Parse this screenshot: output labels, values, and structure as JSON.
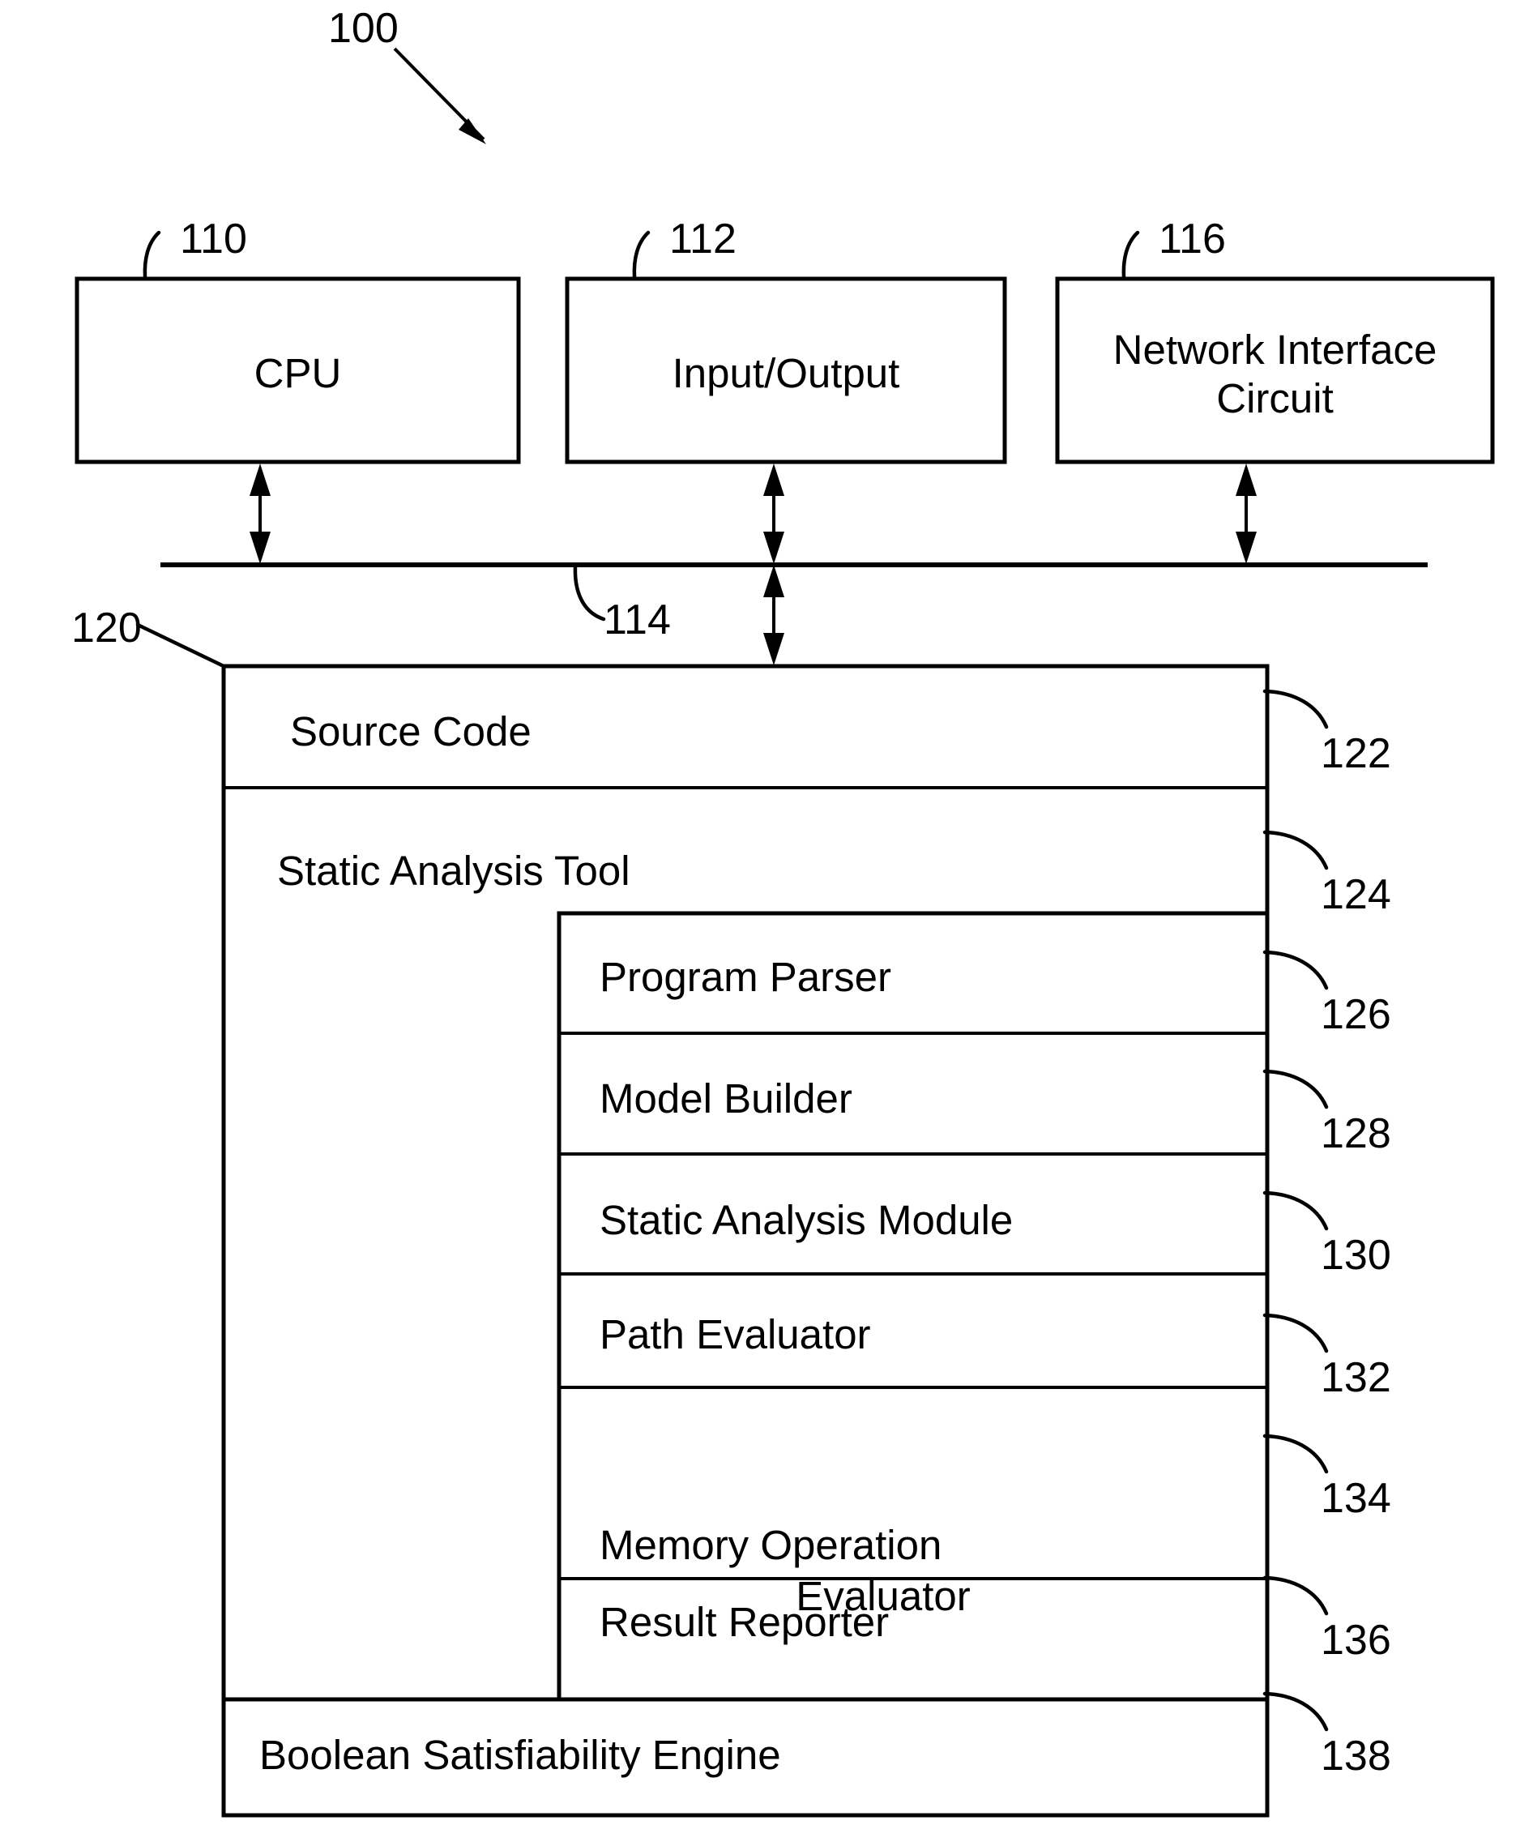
{
  "figure": {
    "system_ref": "100",
    "bus_ref": "114",
    "memory_ref": "120"
  },
  "hardware": {
    "blocks": [
      {
        "label": "CPU",
        "ref": "110"
      },
      {
        "label": "Input/Output",
        "ref": "112"
      },
      {
        "label": "Network Interface\nCircuit",
        "ref": "116"
      }
    ]
  },
  "memory": {
    "source_code": {
      "label": "Source Code",
      "ref": "122"
    },
    "static_analysis_tool": {
      "label": "Static Analysis Tool",
      "ref": "124"
    },
    "modules": [
      {
        "label": "Program Parser",
        "ref": "126"
      },
      {
        "label": "Model Builder",
        "ref": "128"
      },
      {
        "label": "Static Analysis Module",
        "ref": "130"
      },
      {
        "label": "Path Evaluator",
        "ref": "132"
      },
      {
        "label": "Memory Operation\nEvaluator",
        "ref": "134"
      },
      {
        "label": "Result Reporter",
        "ref": "136"
      }
    ],
    "sat_engine": {
      "label": "Boolean Satisfiability Engine",
      "ref": "138"
    }
  },
  "colors": {
    "ink": "#000000",
    "paper": "#ffffff"
  }
}
